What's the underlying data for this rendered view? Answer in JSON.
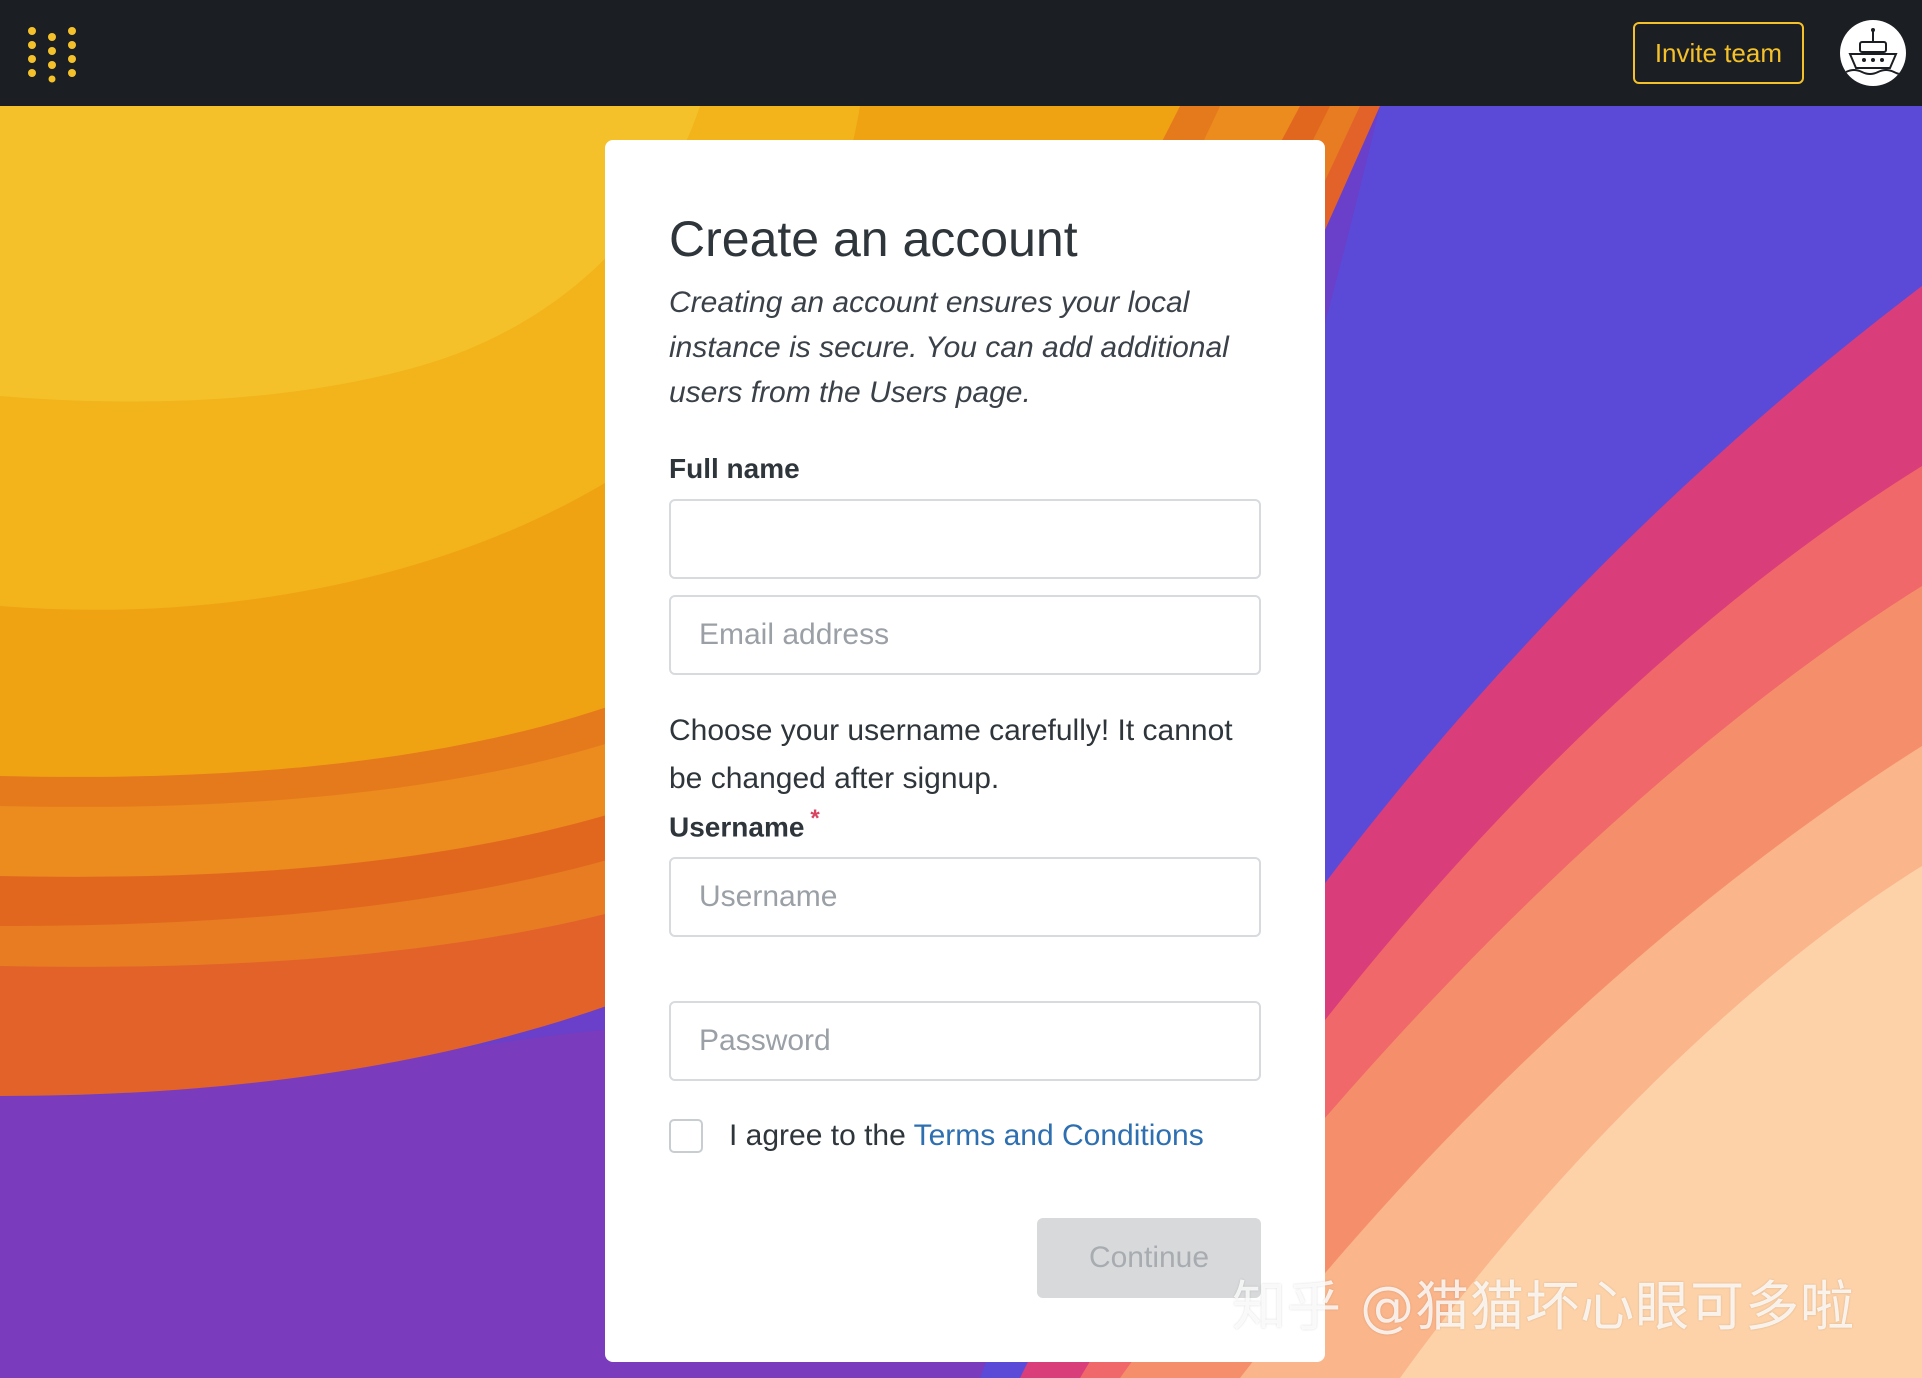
{
  "header": {
    "logo_icon": "metabase-dots-logo-icon",
    "invite_label": "Invite team",
    "avatar_icon": "ship-avatar-icon"
  },
  "card": {
    "title": "Create an account",
    "subtitle": "Creating an account ensures your local instance is secure. You can add additional users from the Users page.",
    "full_name_label": "Full name",
    "full_name_value": "",
    "email_placeholder": "Email address",
    "username_help": "Choose your username carefully! It cannot be changed after signup.",
    "username_label": "Username",
    "required_mark": "*",
    "username_placeholder": "Username",
    "password_placeholder": "Password",
    "agree_prefix": "I agree to the ",
    "terms_link": "Terms and Conditions",
    "continue_label": "Continue"
  },
  "watermark": "知乎 @猫猫坏心眼可多啦",
  "colors": {
    "accent_yellow": "#f4c12b",
    "link_blue": "#2d6fb1",
    "required_red": "#d9455f",
    "topbar_bg": "#1b1e22"
  }
}
